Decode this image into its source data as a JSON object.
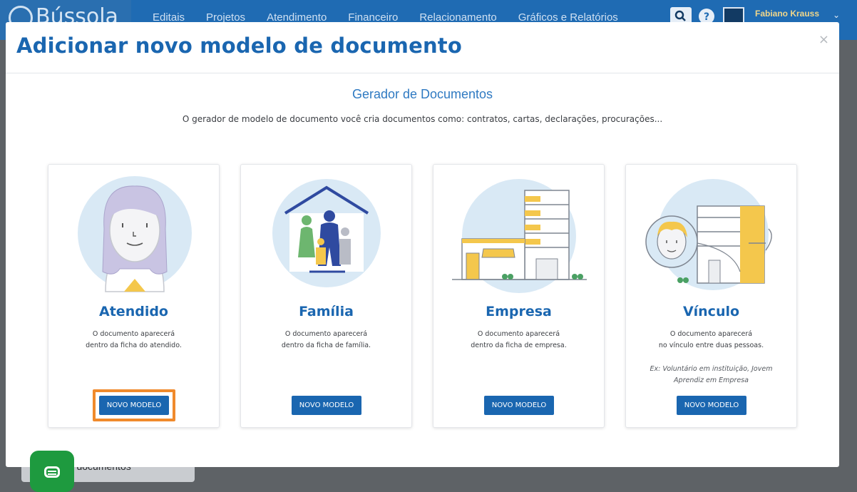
{
  "app": {
    "logo_text": "Bússola",
    "nav": [
      "Editais",
      "Projetos",
      "Atendimento",
      "Financeiro",
      "Relacionamento",
      "Gráficos e Relatórios"
    ],
    "user_name": "Fabiano Krauss",
    "accent": "#1a66b0"
  },
  "background": {
    "sidebar_item_label": "de documentos"
  },
  "modal": {
    "title": "Adicionar novo modelo de documento",
    "close_glyph": "×",
    "subtitle": "Gerador de Documentos",
    "description": "O gerador de modelo de documento você cria documentos como: contratos, cartas, declarações, procurações...",
    "cards": [
      {
        "icon": "woman-avatar-icon",
        "title": "Atendido",
        "desc_line1": "O documento aparecerá",
        "desc_line2": "dentro da ficha do atendido.",
        "button": "NOVO MODELO",
        "highlighted": true
      },
      {
        "icon": "family-house-icon",
        "title": "Família",
        "desc_line1": "O documento aparecerá",
        "desc_line2": "dentro da ficha de família.",
        "button": "NOVO MODELO"
      },
      {
        "icon": "company-building-icon",
        "title": "Empresa",
        "desc_line1": "O documento aparecerá",
        "desc_line2": "dentro da ficha de empresa.",
        "button": "NOVO MODELO"
      },
      {
        "icon": "link-person-building-icon",
        "title": "Vínculo",
        "desc_line1": "O documento aparecerá",
        "desc_line2": "no vínculo entre duas pessoas.",
        "example_line1": "Ex: Voluntário em instituição, Jovem",
        "example_line2": "Aprendiz em Empresa",
        "button": "NOVO MODELO"
      }
    ]
  },
  "colors": {
    "highlight": "#f08a2c",
    "chat": "#1e9a3f"
  }
}
